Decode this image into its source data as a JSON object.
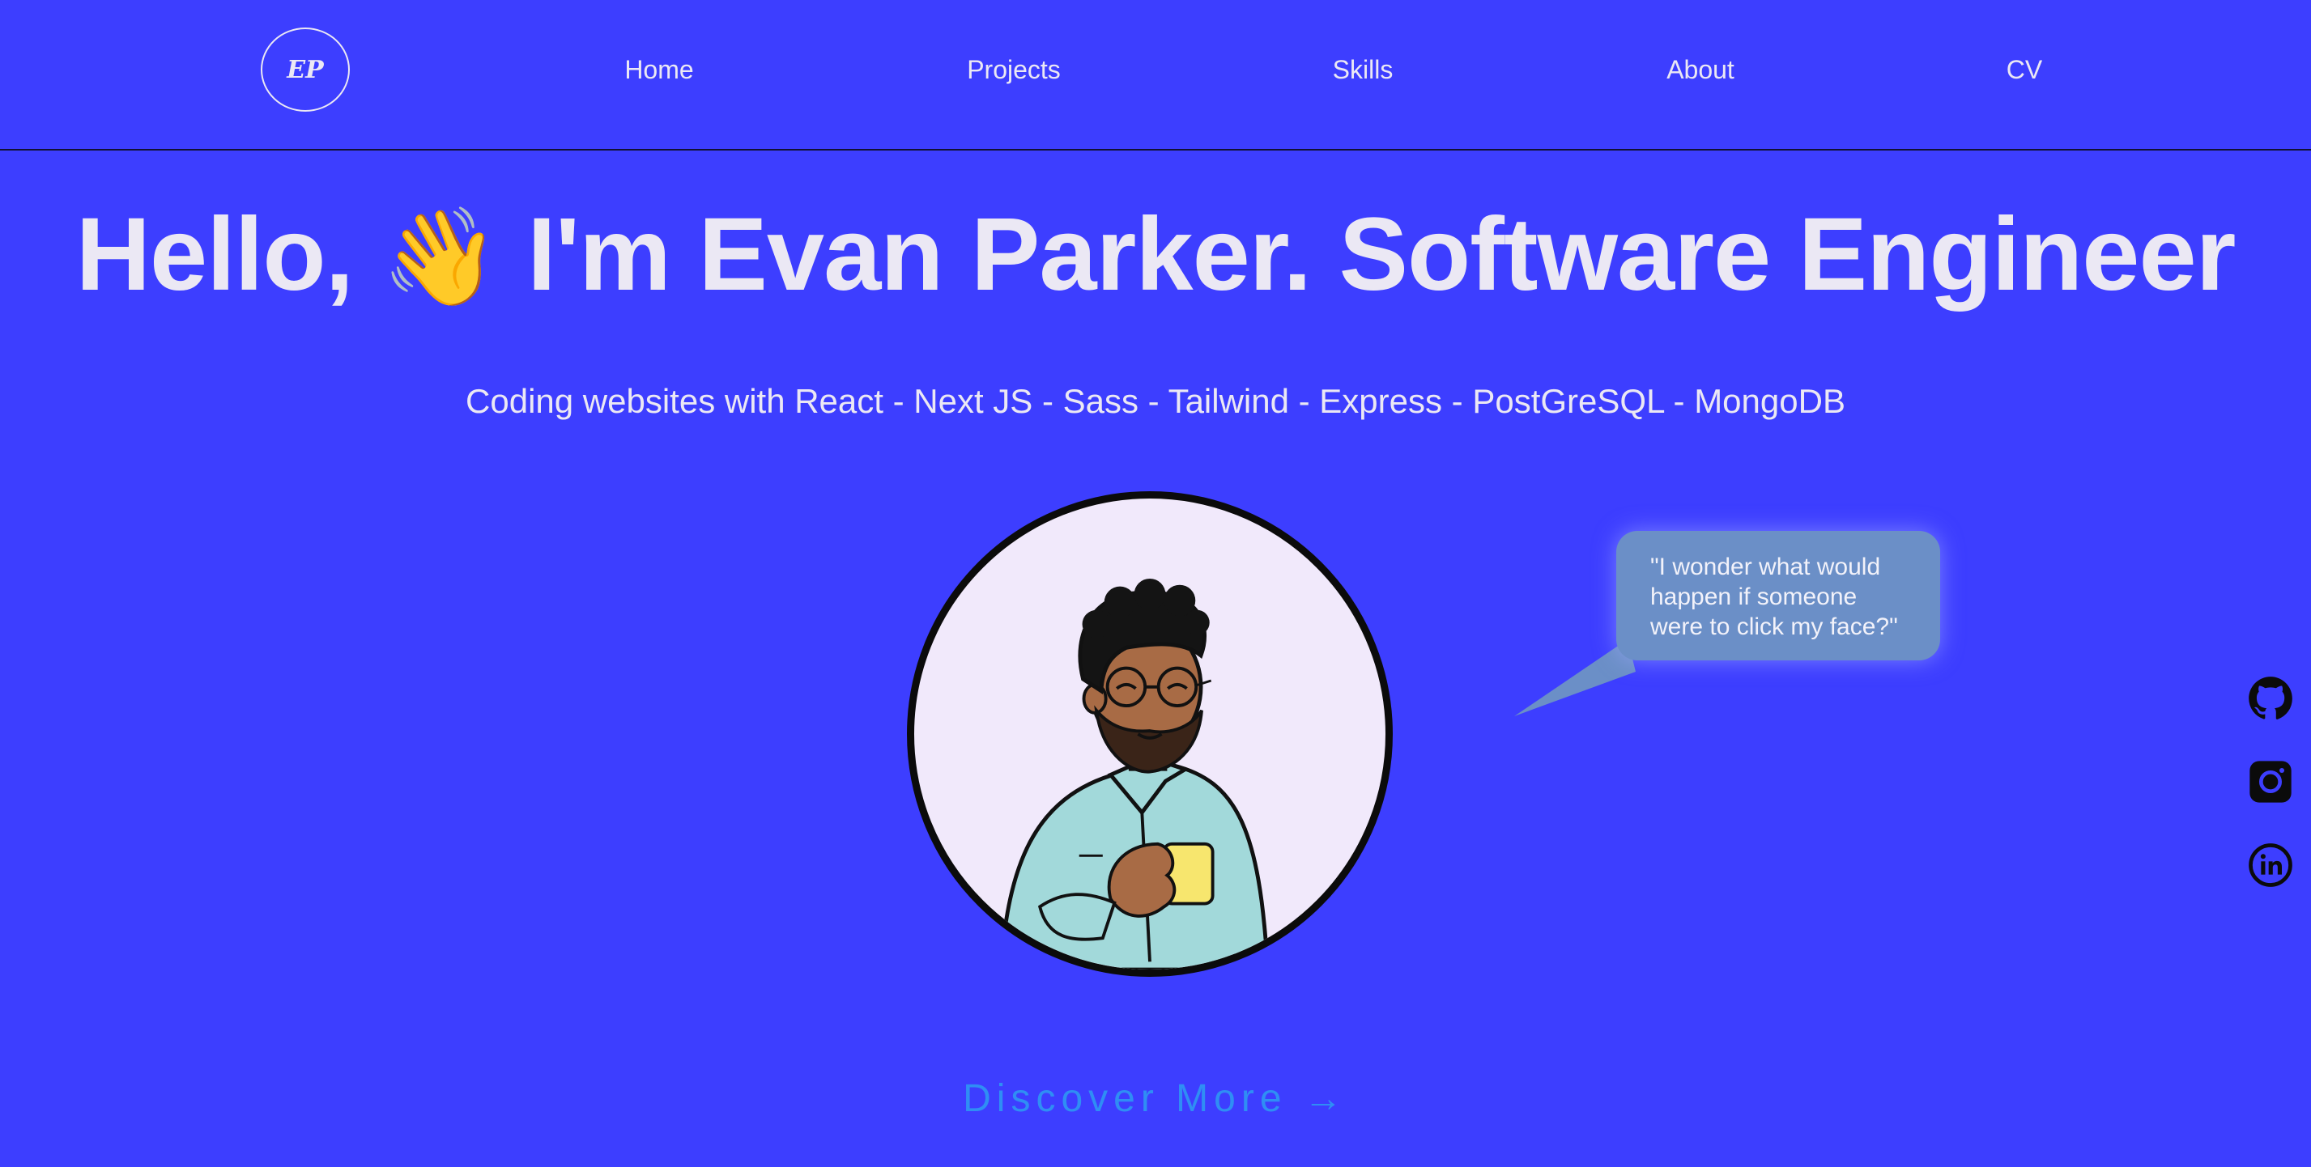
{
  "header": {
    "logo_text": "EP",
    "nav": [
      {
        "label": "Home"
      },
      {
        "label": "Projects"
      },
      {
        "label": "Skills"
      },
      {
        "label": "About"
      },
      {
        "label": "CV"
      }
    ]
  },
  "hero": {
    "greeting": "Hello,",
    "wave_emoji": "👋",
    "headline": "I'm Evan Parker. Software Engineer",
    "subtitle": "Coding websites with React - Next JS - Sass - Tailwind - Express - PostGreSQL - MongoDB"
  },
  "speech_bubble": {
    "text": "\"I wonder what would happen if someone were to click my face?\""
  },
  "cta": {
    "label": "Discover More",
    "arrow": "→"
  },
  "social": [
    {
      "icon": "github-icon"
    },
    {
      "icon": "instagram-icon"
    },
    {
      "icon": "linkedin-icon"
    }
  ],
  "colors": {
    "background": "#3d3eff",
    "text": "#ebe8f4",
    "accent": "#2f8ef4",
    "bubble": "#6b8fc7"
  }
}
